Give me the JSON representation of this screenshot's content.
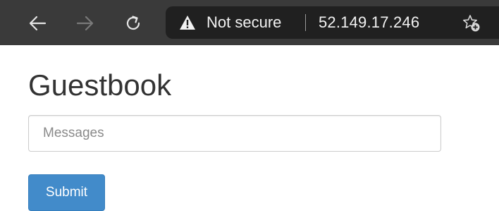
{
  "browser": {
    "nav": {
      "back_icon": "arrow-left-icon",
      "forward_icon": "arrow-right-icon",
      "reload_icon": "reload-icon"
    },
    "address_bar": {
      "security_icon": "warning-triangle-icon",
      "security_label": "Not secure",
      "url": "52.149.17.246",
      "favorite_icon": "star-add-icon"
    },
    "colors": {
      "toolbar_bg": "#3a3a3a",
      "address_bg": "#202020"
    }
  },
  "page": {
    "title": "Guestbook",
    "message_input": {
      "placeholder": "Messages",
      "value": ""
    },
    "submit_label": "Submit",
    "colors": {
      "primary_button": "#428bca",
      "title_text": "#333333"
    }
  }
}
